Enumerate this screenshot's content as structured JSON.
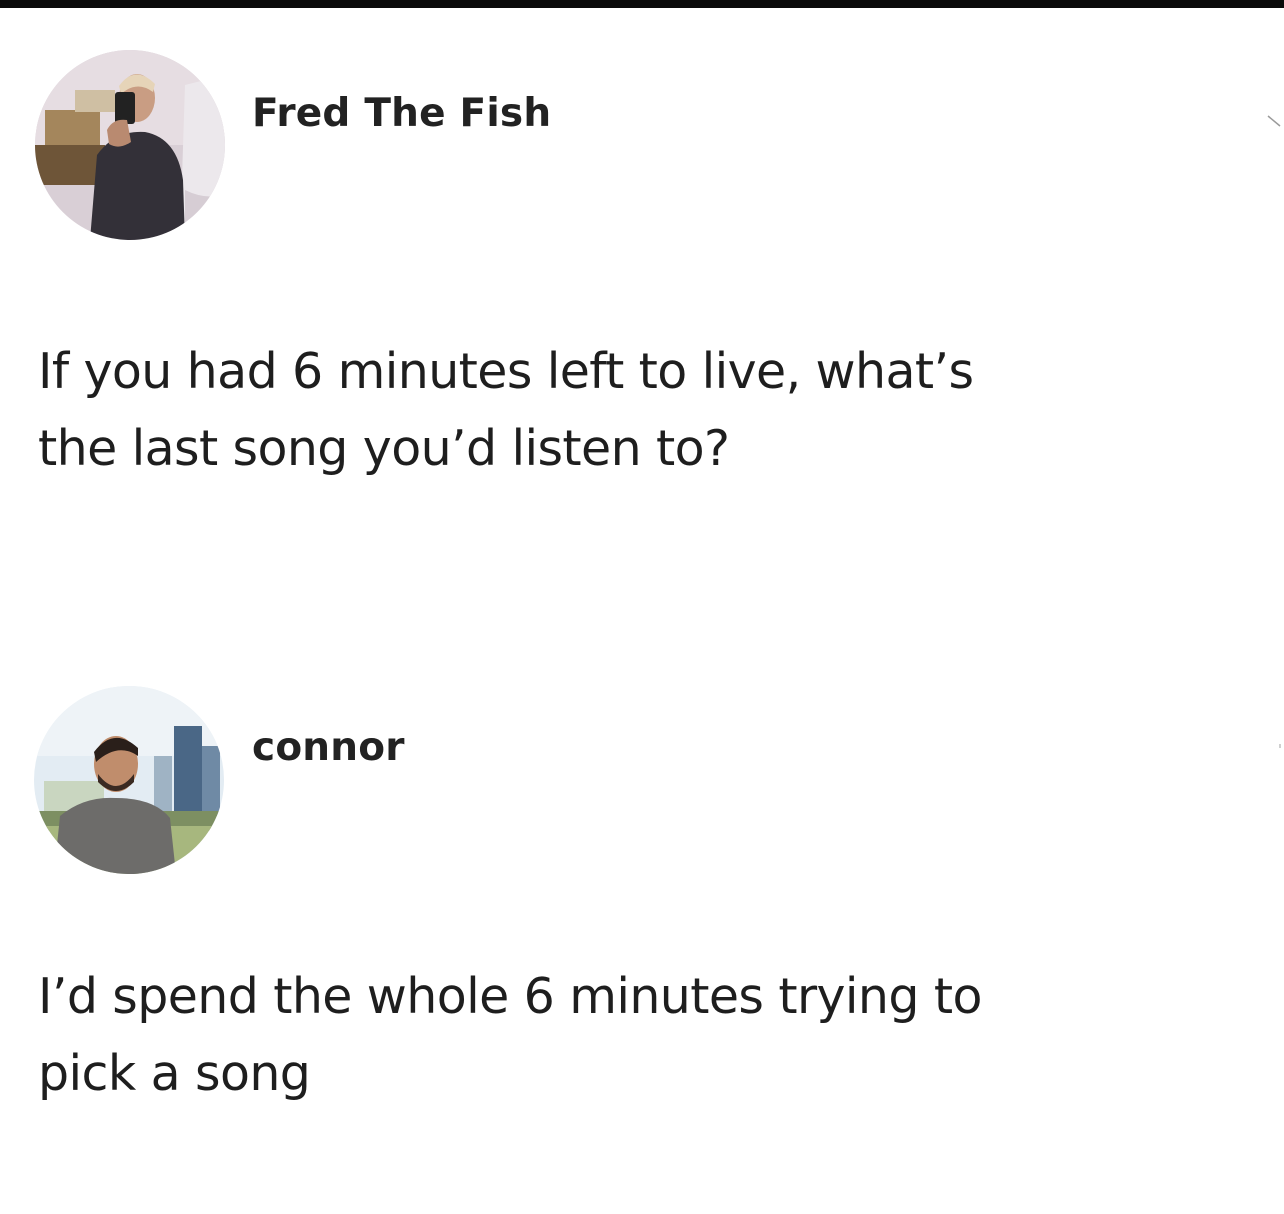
{
  "posts": [
    {
      "author": "Fred The Fish",
      "avatar_icon": "profile-photo-mirror-selfie",
      "text_lines": [
        "If you had 6 minutes left to live, what’s",
        "the last song you’d listen to?"
      ]
    },
    {
      "author": "connor",
      "avatar_icon": "profile-photo-outdoor-portrait",
      "text_lines": [
        "I’d spend the whole 6 minutes trying to",
        "pick a song"
      ]
    }
  ],
  "colors": {
    "background": "#ffffff",
    "text": "#1e1e1e",
    "top_bar": "#0a0a0a"
  }
}
